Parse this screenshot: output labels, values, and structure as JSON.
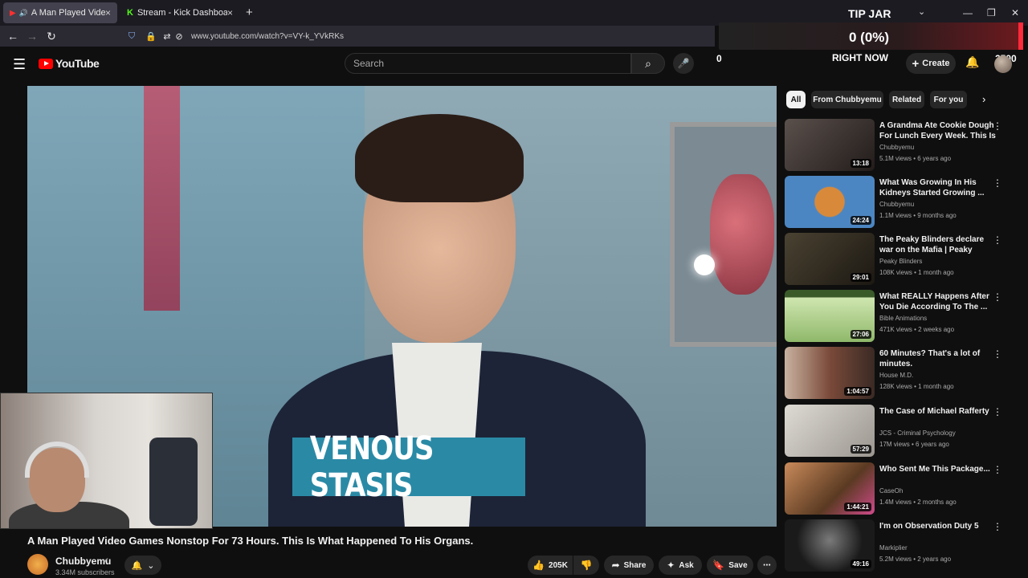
{
  "browser": {
    "tabs": [
      {
        "title": "A Man Played Video Games",
        "close": "×",
        "favicon": "youtube-favicon"
      },
      {
        "title": "Stream - Kick Dashboard",
        "close": "×",
        "favicon": "kick-favicon"
      }
    ],
    "new_tab": "+",
    "url": "www.youtube.com/watch?v=VY-k_YVkRKs"
  },
  "tipjar": {
    "title": "TIP JAR",
    "amount": "0 (0%)",
    "right_now": "RIGHT NOW",
    "left_value": "0",
    "right_value": "2500",
    "progress_fraction": 0
  },
  "youtube": {
    "logo": "YouTube",
    "search_placeholder": "Search",
    "create_label": "Create",
    "caption_overlay": "VENOUS STASIS",
    "video_title": "A Man Played Video Games Nonstop For 73 Hours. This Is What Happened To His Organs.",
    "channel": {
      "name": "Chubbyemu",
      "subscribers": "3.34M subscribers"
    },
    "actions": {
      "likes": "205K",
      "share": "Share",
      "ask": "Ask",
      "save": "Save"
    },
    "chips": [
      "All",
      "From Chubbyemu",
      "Related",
      "For you"
    ],
    "recommendations": [
      {
        "title": "A Grandma Ate Cookie Dough For Lunch Every Week. This Is ...",
        "channel": "Chubbyemu",
        "meta": "5.1M views • 6 years ago",
        "duration": "13:18",
        "thumb_color": "#3a3230"
      },
      {
        "title": "What Was Growing In His Kidneys Started Growing ...",
        "channel": "Chubbyemu",
        "meta": "1.1M views • 9 months ago",
        "duration": "24:24",
        "thumb_color": "#4c86c2"
      },
      {
        "title": "The Peaky Blinders declare war on the Mafia | Peaky Blinders",
        "channel": "Peaky Blinders",
        "meta": "108K views • 1 month ago",
        "duration": "29:01",
        "thumb_color": "#2f2a22"
      },
      {
        "title": "What REALLY Happens After You Die According To The ...",
        "channel": "Bible Animations",
        "meta": "471K views • 2 weeks ago",
        "duration": "27:06",
        "thumb_color": "#a9c98a"
      },
      {
        "title": "60 Minutes? That's a lot of minutes.",
        "channel": "House M.D.",
        "meta": "128K views • 1 month ago",
        "duration": "1:04:57",
        "thumb_color": "#8a5a48"
      },
      {
        "title": "The Case of Michael Rafferty",
        "channel": "JCS - Criminal Psychology",
        "meta": "17M views • 6 years ago",
        "duration": "57:29",
        "thumb_color": "#b8b4ae"
      },
      {
        "title": "Who Sent Me This Package...",
        "channel": "CaseOh",
        "meta": "1.4M views • 2 months ago",
        "duration": "1:44:21",
        "thumb_color": "#6b4a32"
      },
      {
        "title": "I'm on Observation Duty 5",
        "channel": "Markiplier",
        "meta": "5.2M views • 2 years ago",
        "duration": "49:16",
        "thumb_color": "#2a2a2a"
      }
    ]
  }
}
